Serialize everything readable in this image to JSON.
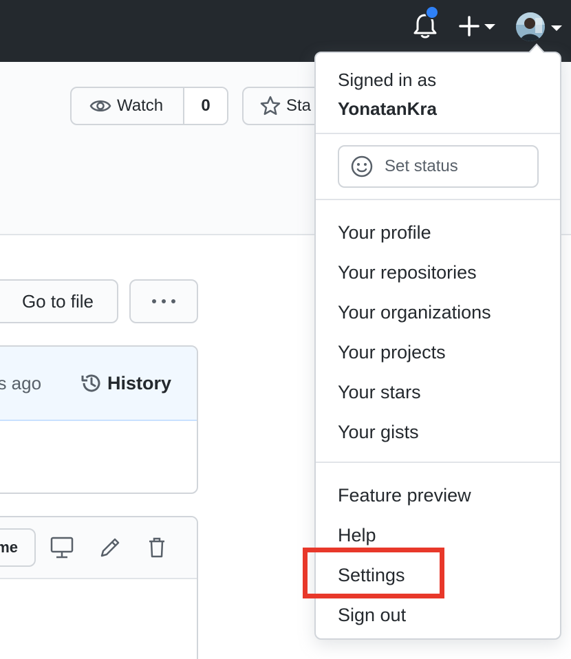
{
  "header": {
    "notification_icon": "bell-icon",
    "create_icon": "plus-icon",
    "avatar_icon": "user-avatar",
    "colors": {
      "bar": "#24292e",
      "notification_dot": "#2f81f7"
    }
  },
  "repo": {
    "watch_label": "Watch",
    "watch_count": "0",
    "star_label": "Sta"
  },
  "content": {
    "go_to_file": "Go to file",
    "commit_time_text": "es ago",
    "history_label": "History",
    "file_button_label": "me"
  },
  "menu": {
    "signed_in_label": "Signed in as",
    "username": "YonatanKra",
    "set_status": "Set status",
    "section1": [
      "Your profile",
      "Your repositories",
      "Your organizations",
      "Your projects",
      "Your stars",
      "Your gists"
    ],
    "section2": [
      "Feature preview",
      "Help",
      "Settings",
      "Sign out"
    ],
    "highlighted_item": "Settings",
    "highlight_color": "#e8382a"
  }
}
